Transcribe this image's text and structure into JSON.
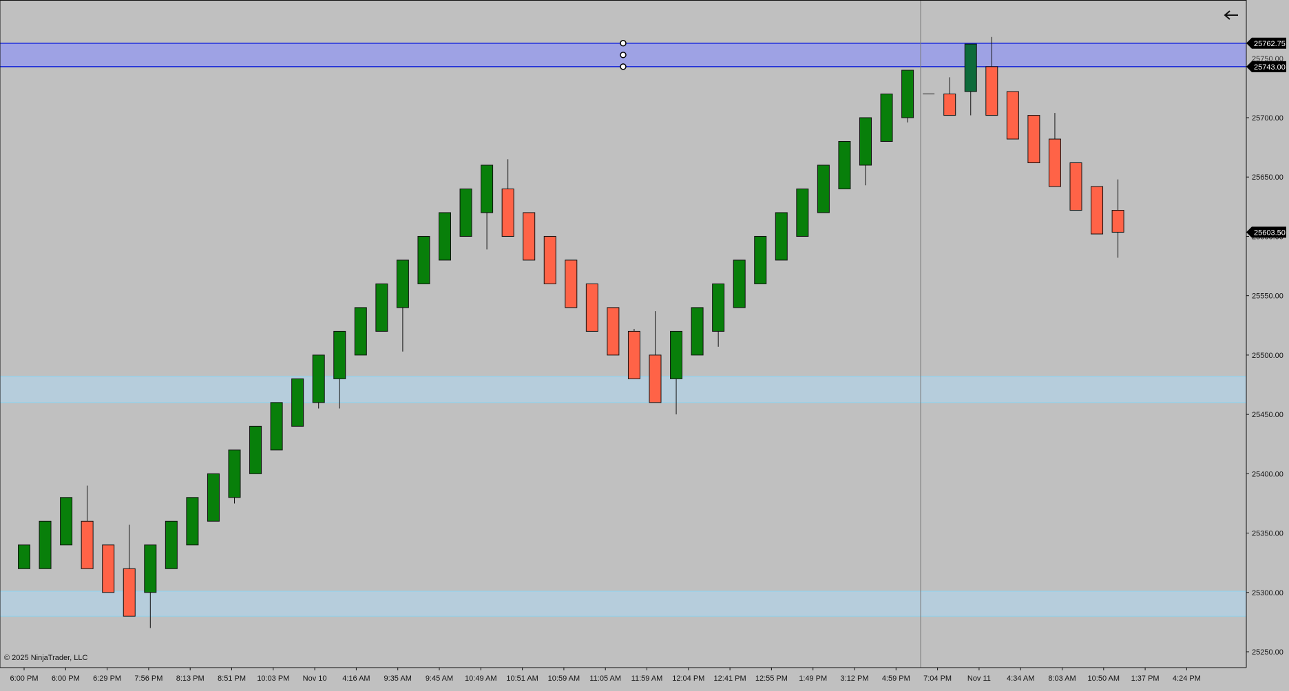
{
  "app": {
    "copyright": "© 2025 NinjaTrader, LLC",
    "back_icon": "arrow-left-icon"
  },
  "colors": {
    "background": "#c0c0c0",
    "up_candle": "#087f0a",
    "down_candle": "#ff6347",
    "highlight_candle": "#0d6b3a",
    "zone_blue_fill": "#9a9ee8",
    "zone_blue_line": "#1020d8",
    "zone_light_fill": "#b4cfe0",
    "zone_light_line": "#8cd4f0",
    "price_tag_bg": "#000000",
    "price_tag_text": "#ffffff"
  },
  "chart_data": {
    "type": "candlestick",
    "x_tick_labels": [
      "6:00 PM",
      "6:00 PM",
      "6:29 PM",
      "7:56 PM",
      "8:13 PM",
      "8:51 PM",
      "10:03 PM",
      "Nov 10",
      "4:16 AM",
      "9:35 AM",
      "9:45 AM",
      "10:49 AM",
      "10:51 AM",
      "10:59 AM",
      "11:05 AM",
      "11:59 AM",
      "12:04 PM",
      "12:41 PM",
      "12:55 PM",
      "1:49 PM",
      "3:12 PM",
      "4:59 PM",
      "7:04 PM",
      "Nov 11",
      "4:34 AM",
      "8:03 AM",
      "10:50 AM",
      "1:37 PM",
      "4:24 PM"
    ],
    "y_tick_labels": [
      "25700.00",
      "25650.00",
      "25600.00",
      "25550.00",
      "25500.00",
      "25450.00",
      "25400.00",
      "25350.00",
      "25300.00",
      "25250.00"
    ],
    "y_ticks": [
      25700,
      25650,
      25600,
      25550,
      25500,
      25450,
      25400,
      25350,
      25300,
      25250
    ],
    "ylim": [
      25240,
      25795
    ],
    "price_tags": [
      {
        "label": "25762.75",
        "value": 25762.75
      },
      {
        "label": "25743.00",
        "value": 25743.0
      },
      {
        "label": "25603.50",
        "value": 25603.5
      }
    ],
    "hidden_tag_text": "25750.00",
    "zones": [
      {
        "name": "resistance-zone",
        "top": 25762.75,
        "bottom": 25743.0,
        "style": "blue"
      },
      {
        "name": "support-zone-upper",
        "top": 25482,
        "bottom": 25460,
        "style": "light"
      },
      {
        "name": "support-zone-lower",
        "top": 25301,
        "bottom": 25280,
        "style": "light"
      }
    ],
    "crosshair_x_label": "4:59 PM",
    "candles": [
      {
        "o": 25320,
        "h": 25340,
        "l": 25320,
        "c": 25340
      },
      {
        "o": 25320,
        "h": 25360,
        "l": 25320,
        "c": 25360
      },
      {
        "o": 25340,
        "h": 25380,
        "l": 25340,
        "c": 25380
      },
      {
        "o": 25360,
        "h": 25390,
        "l": 25320,
        "c": 25320
      },
      {
        "o": 25340,
        "h": 25340,
        "l": 25300,
        "c": 25300
      },
      {
        "o": 25320,
        "h": 25357,
        "l": 25280,
        "c": 25280
      },
      {
        "o": 25300,
        "h": 25340,
        "l": 25270,
        "c": 25340
      },
      {
        "o": 25320,
        "h": 25360,
        "l": 25320,
        "c": 25360
      },
      {
        "o": 25340,
        "h": 25380,
        "l": 25340,
        "c": 25380
      },
      {
        "o": 25360,
        "h": 25400,
        "l": 25360,
        "c": 25400
      },
      {
        "o": 25380,
        "h": 25420,
        "l": 25375,
        "c": 25420
      },
      {
        "o": 25400,
        "h": 25440,
        "l": 25400,
        "c": 25440
      },
      {
        "o": 25420,
        "h": 25460,
        "l": 25420,
        "c": 25460
      },
      {
        "o": 25440,
        "h": 25480,
        "l": 25440,
        "c": 25480
      },
      {
        "o": 25460,
        "h": 25500,
        "l": 25455,
        "c": 25500
      },
      {
        "o": 25480,
        "h": 25520,
        "l": 25455,
        "c": 25520
      },
      {
        "o": 25500,
        "h": 25540,
        "l": 25500,
        "c": 25540
      },
      {
        "o": 25520,
        "h": 25560,
        "l": 25520,
        "c": 25560
      },
      {
        "o": 25540,
        "h": 25580,
        "l": 25503,
        "c": 25580
      },
      {
        "o": 25560,
        "h": 25600,
        "l": 25560,
        "c": 25600
      },
      {
        "o": 25580,
        "h": 25620,
        "l": 25580,
        "c": 25620
      },
      {
        "o": 25600,
        "h": 25640,
        "l": 25600,
        "c": 25640
      },
      {
        "o": 25620,
        "h": 25660,
        "l": 25589,
        "c": 25660
      },
      {
        "o": 25640,
        "h": 25665,
        "l": 25600,
        "c": 25600
      },
      {
        "o": 25620,
        "h": 25620,
        "l": 25580,
        "c": 25580
      },
      {
        "o": 25600,
        "h": 25600,
        "l": 25560,
        "c": 25560
      },
      {
        "o": 25580,
        "h": 25580,
        "l": 25540,
        "c": 25540
      },
      {
        "o": 25560,
        "h": 25560,
        "l": 25520,
        "c": 25520
      },
      {
        "o": 25540,
        "h": 25540,
        "l": 25500,
        "c": 25500
      },
      {
        "o": 25520,
        "h": 25522,
        "l": 25480,
        "c": 25480
      },
      {
        "o": 25500,
        "h": 25537,
        "l": 25460,
        "c": 25460
      },
      {
        "o": 25480,
        "h": 25520,
        "l": 25450,
        "c": 25520
      },
      {
        "o": 25500,
        "h": 25540,
        "l": 25500,
        "c": 25540
      },
      {
        "o": 25520,
        "h": 25560,
        "l": 25507,
        "c": 25560
      },
      {
        "o": 25540,
        "h": 25580,
        "l": 25540,
        "c": 25580
      },
      {
        "o": 25560,
        "h": 25600,
        "l": 25560,
        "c": 25600
      },
      {
        "o": 25580,
        "h": 25620,
        "l": 25580,
        "c": 25620
      },
      {
        "o": 25600,
        "h": 25640,
        "l": 25600,
        "c": 25640
      },
      {
        "o": 25620,
        "h": 25660,
        "l": 25620,
        "c": 25660
      },
      {
        "o": 25640,
        "h": 25680,
        "l": 25640,
        "c": 25680
      },
      {
        "o": 25660,
        "h": 25700,
        "l": 25643,
        "c": 25700
      },
      {
        "o": 25680,
        "h": 25720,
        "l": 25680,
        "c": 25720
      },
      {
        "o": 25700,
        "h": 25740,
        "l": 25696,
        "c": 25740
      },
      {
        "o": 25720,
        "h": 25720,
        "l": 25720,
        "c": 25720
      },
      {
        "o": 25720,
        "h": 25734,
        "l": 25702,
        "c": 25702
      },
      {
        "o": 25722,
        "h": 25762,
        "l": 25702,
        "c": 25762
      },
      {
        "o": 25743,
        "h": 25768,
        "l": 25702,
        "c": 25702
      },
      {
        "o": 25722,
        "h": 25722,
        "l": 25682,
        "c": 25682
      },
      {
        "o": 25702,
        "h": 25702,
        "l": 25662,
        "c": 25662
      },
      {
        "o": 25682,
        "h": 25704,
        "l": 25642,
        "c": 25642
      },
      {
        "o": 25662,
        "h": 25662,
        "l": 25622,
        "c": 25622
      },
      {
        "o": 25642,
        "h": 25642,
        "l": 25602,
        "c": 25602
      },
      {
        "o": 25622,
        "h": 25648,
        "l": 25582,
        "c": 25603.5
      }
    ]
  }
}
